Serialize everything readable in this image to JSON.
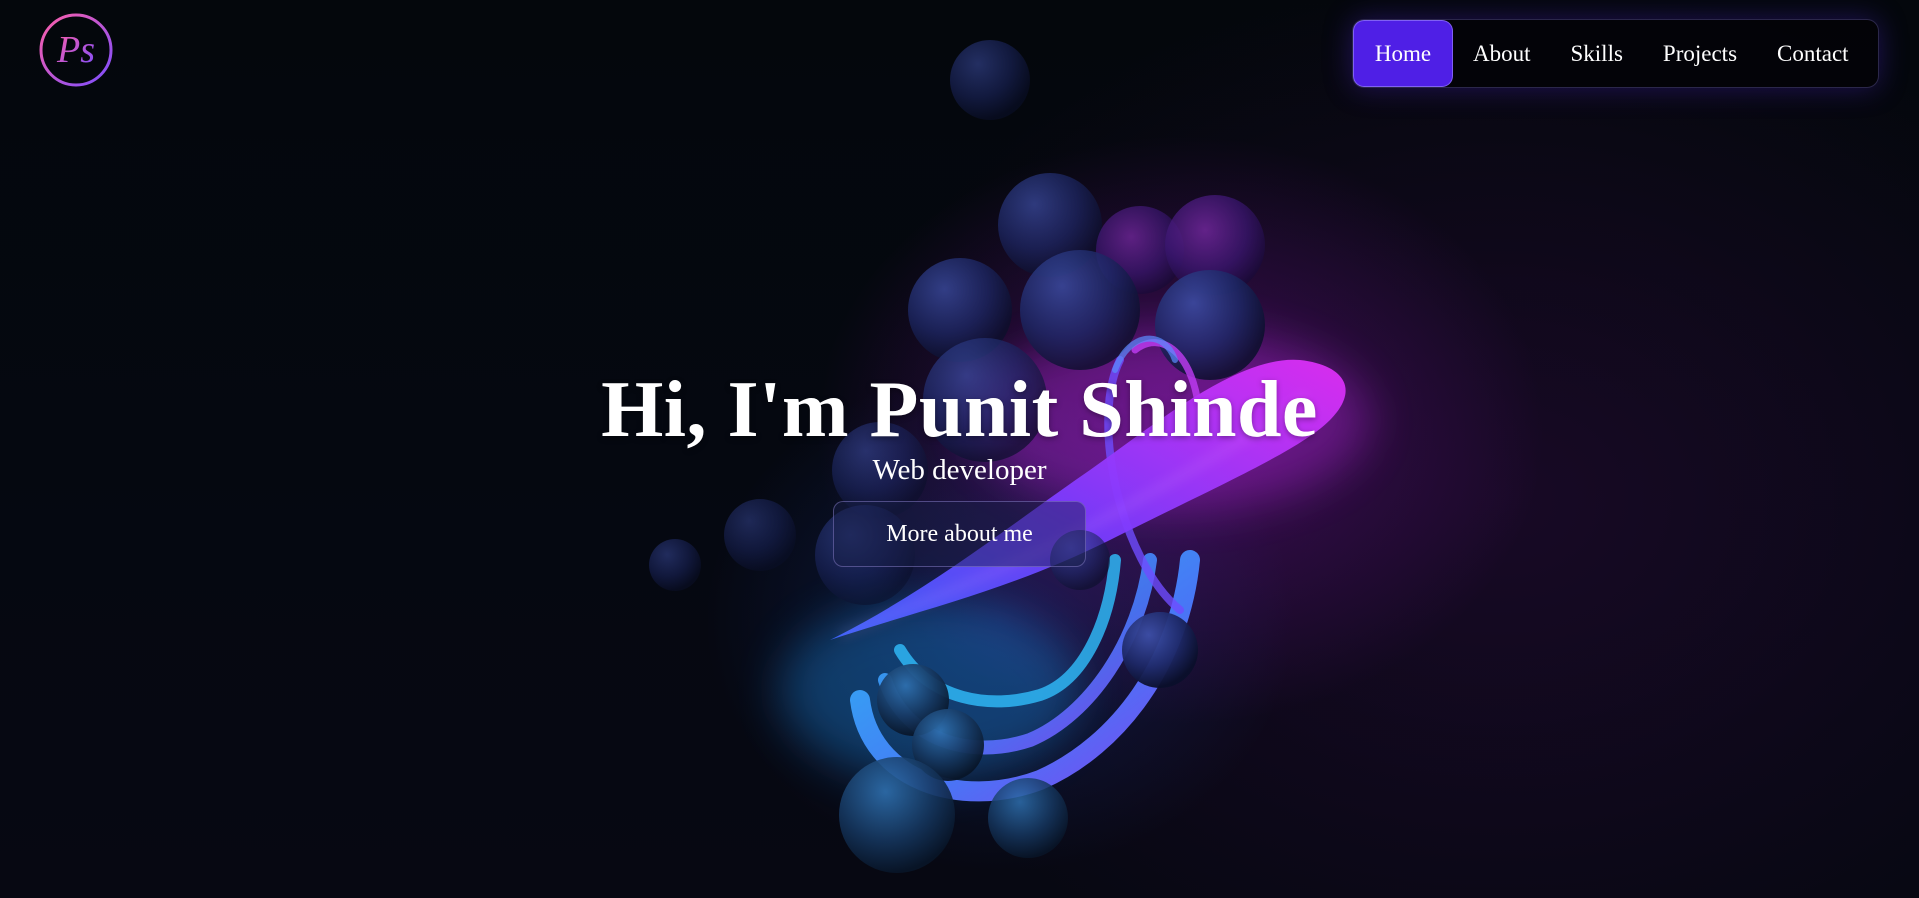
{
  "logo": {
    "text": "Ps",
    "icon": "ps-monogram-logo"
  },
  "nav": {
    "items": [
      {
        "label": "Home",
        "active": true
      },
      {
        "label": "About",
        "active": false
      },
      {
        "label": "Skills",
        "active": false
      },
      {
        "label": "Projects",
        "active": false
      },
      {
        "label": "Contact",
        "active": false
      }
    ]
  },
  "hero": {
    "title": "Hi, I'm Punit Shinde",
    "subtitle": "Web developer",
    "cta_label": "More about me"
  },
  "colors": {
    "accent": "#4f1fe6",
    "glow_magenta": "#d62cf2",
    "glow_cyan": "#2fb6f5",
    "background": "#05060b"
  }
}
